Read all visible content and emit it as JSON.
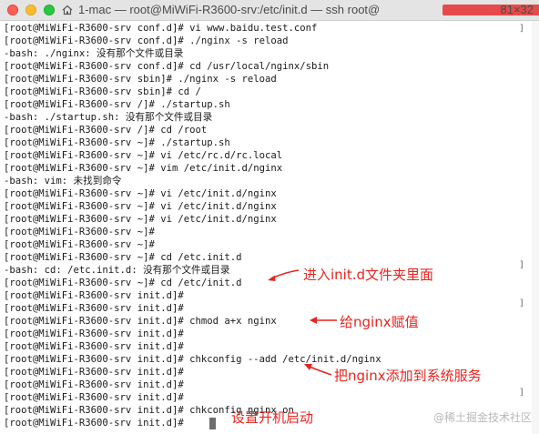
{
  "window": {
    "title": "1-mac — root@MiWiFi-R3600-srv:/etc/init.d — ssh root@",
    "dimensions": "81×32"
  },
  "terminal": {
    "lines": [
      "[root@MiWiFi-R3600-srv conf.d]# vi www.baidu.test.conf",
      "[root@MiWiFi-R3600-srv conf.d]# ./nginx -s reload",
      "-bash: ./nginx: 没有那个文件或目录",
      "[root@MiWiFi-R3600-srv conf.d]# cd /usr/local/nginx/sbin",
      "[root@MiWiFi-R3600-srv sbin]# ./nginx -s reload",
      "[root@MiWiFi-R3600-srv sbin]# cd /",
      "[root@MiWiFi-R3600-srv /]# ./startup.sh",
      "-bash: ./startup.sh: 没有那个文件或目录",
      "[root@MiWiFi-R3600-srv /]# cd /root",
      "[root@MiWiFi-R3600-srv ~]# ./startup.sh",
      "[root@MiWiFi-R3600-srv ~]# vi /etc/rc.d/rc.local",
      "[root@MiWiFi-R3600-srv ~]# vim /etc/init.d/nginx",
      "-bash: vim: 未找到命令",
      "[root@MiWiFi-R3600-srv ~]# vi /etc/init.d/nginx",
      "[root@MiWiFi-R3600-srv ~]# vi /etc/init.d/nginx",
      "[root@MiWiFi-R3600-srv ~]# vi /etc/init.d/nginx",
      "[root@MiWiFi-R3600-srv ~]#",
      "[root@MiWiFi-R3600-srv ~]#",
      "[root@MiWiFi-R3600-srv ~]# cd /etc.init.d",
      "-bash: cd: /etc.init.d: 没有那个文件或目录",
      "[root@MiWiFi-R3600-srv ~]# cd /etc/init.d",
      "[root@MiWiFi-R3600-srv init.d]#",
      "[root@MiWiFi-R3600-srv init.d]#",
      "[root@MiWiFi-R3600-srv init.d]# chmod a+x nginx",
      "[root@MiWiFi-R3600-srv init.d]#",
      "[root@MiWiFi-R3600-srv init.d]#",
      "[root@MiWiFi-R3600-srv init.d]# chkconfig --add /etc/init.d/nginx",
      "[root@MiWiFi-R3600-srv init.d]#",
      "[root@MiWiFi-R3600-srv init.d]#",
      "[root@MiWiFi-R3600-srv init.d]#",
      "[root@MiWiFi-R3600-srv init.d]# chkconfig nginx on",
      "[root@MiWiFi-R3600-srv init.d]# "
    ]
  },
  "annotations": [
    {
      "text": "进入init.d文件夹里面"
    },
    {
      "text": "给nginx赋值"
    },
    {
      "text": "把nginx添加到系统服务"
    },
    {
      "text": "设置开机启动"
    }
  ],
  "watermark": "@稀土掘金技术社区",
  "colors": {
    "annotation": "#e8241f",
    "titlebar": "#e4e4e4",
    "background": "#ffffff",
    "text": "#1a1a1a"
  }
}
